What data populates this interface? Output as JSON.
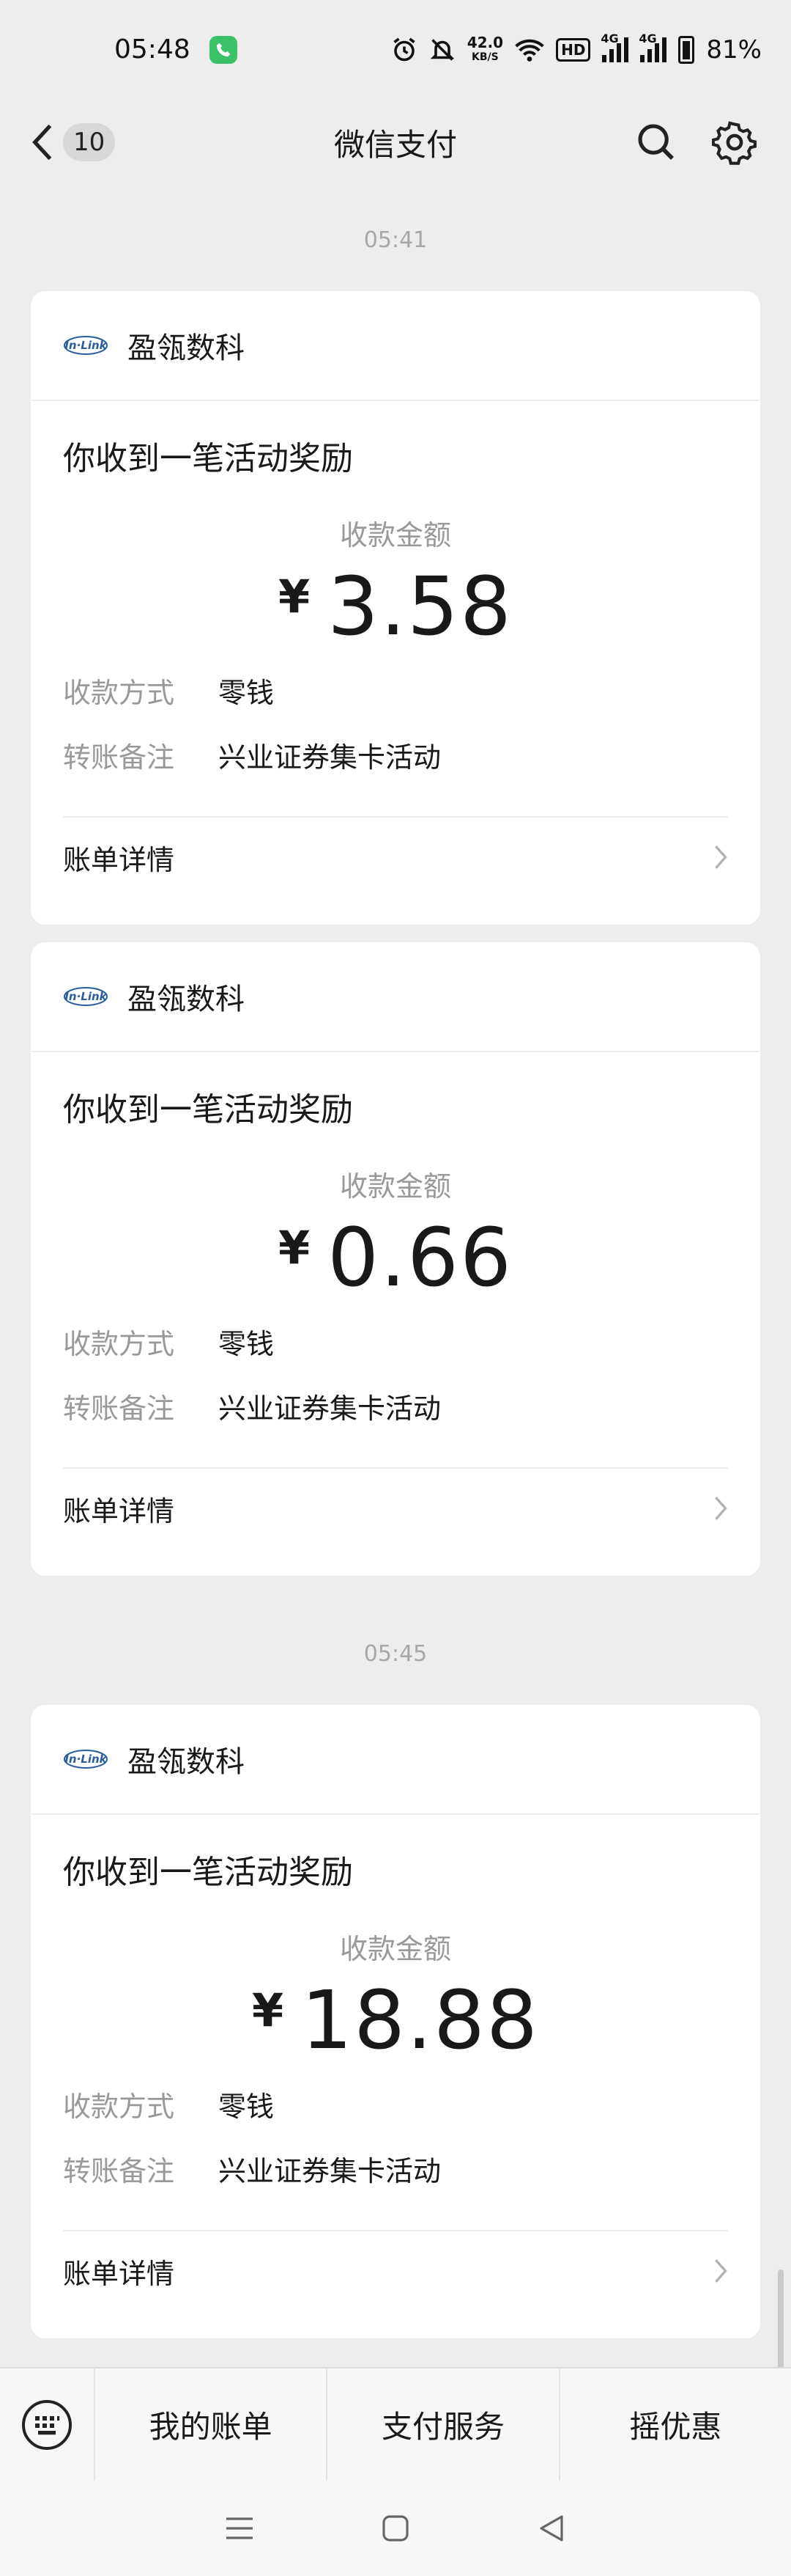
{
  "status_bar": {
    "time": "05:48",
    "net_speed_value": "42.0",
    "net_speed_unit": "KB/S",
    "hd": "HD",
    "signal_label_1": "4G",
    "signal_label_2": "4G",
    "battery": "81%"
  },
  "nav": {
    "unread_count": "10",
    "title": "微信支付"
  },
  "timestamps": [
    "05:41",
    "05:45"
  ],
  "cards": [
    {
      "brand": "盈瓴数科",
      "title": "你收到一笔活动奖励",
      "amount_label": "收款金额",
      "currency": "¥",
      "amount": "3.58",
      "method_key": "收款方式",
      "method_val": "零钱",
      "note_key": "转账备注",
      "note_val": "兴业证券集卡活动",
      "footer": "账单详情"
    },
    {
      "brand": "盈瓴数科",
      "title": "你收到一笔活动奖励",
      "amount_label": "收款金额",
      "currency": "¥",
      "amount": "0.66",
      "method_key": "收款方式",
      "method_val": "零钱",
      "note_key": "转账备注",
      "note_val": "兴业证券集卡活动",
      "footer": "账单详情"
    },
    {
      "brand": "盈瓴数科",
      "title": "你收到一笔活动奖励",
      "amount_label": "收款金额",
      "currency": "¥",
      "amount": "18.88",
      "method_key": "收款方式",
      "method_val": "零钱",
      "note_key": "转账备注",
      "note_val": "兴业证券集卡活动",
      "footer": "账单详情"
    }
  ],
  "bottom_menu": {
    "items": [
      "我的账单",
      "支付服务",
      "摇优惠"
    ]
  },
  "colors": {
    "background": "#ededed",
    "card": "#ffffff",
    "call_indicator": "#3bc168",
    "muted_text": "#999999",
    "brand_logo": "#2a5d9f"
  },
  "icons": [
    "call-icon",
    "alarm-icon",
    "mute-icon",
    "wifi-icon",
    "signal-icon",
    "battery-icon",
    "back-chevron-icon",
    "search-icon",
    "gear-icon",
    "brand-logo-icon",
    "chevron-right-icon",
    "keyboard-icon",
    "menu-lines-icon",
    "home-square-icon",
    "back-triangle-icon"
  ]
}
